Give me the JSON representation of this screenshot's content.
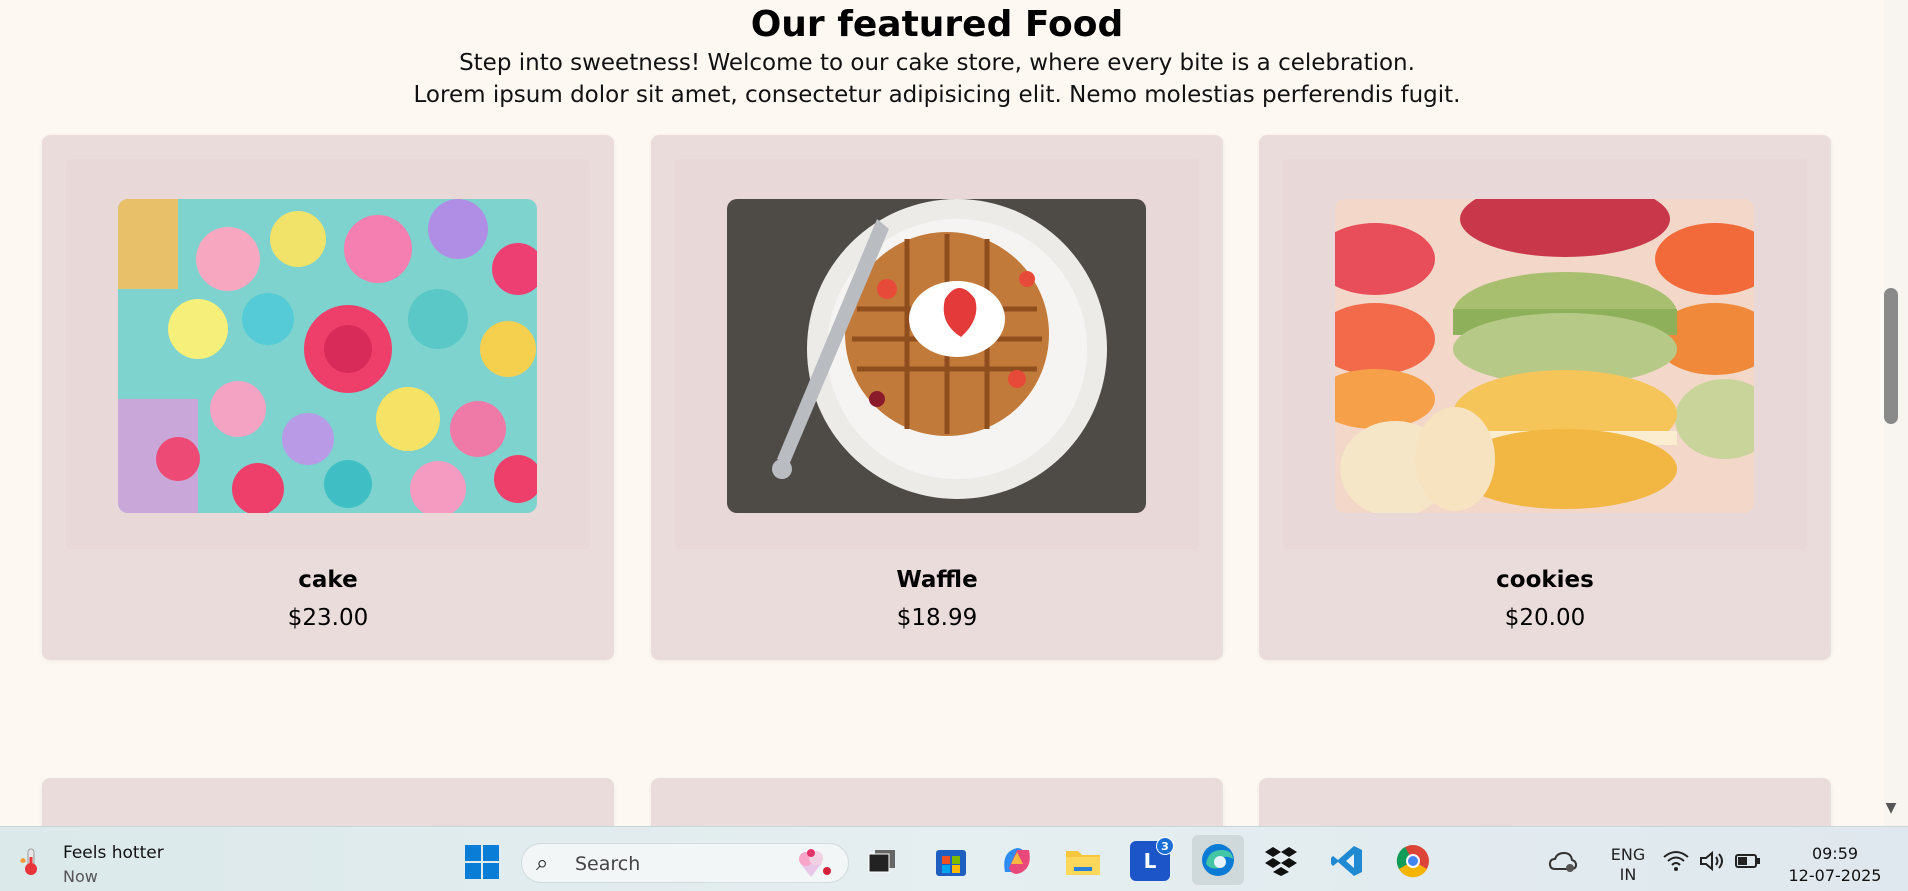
{
  "section": {
    "title": "Our featured Food",
    "subtitle_line1": "Step into sweetness! Welcome to our cake store, where every bite is a celebration.",
    "subtitle_line2": "Lorem ipsum dolor sit amet, consectetur adipisicing elit. Nemo molestias perferendis fugit."
  },
  "products": [
    {
      "name": "cake",
      "price": "$23.00",
      "image": "colorful-frosted-cake"
    },
    {
      "name": "Waffle",
      "price": "$18.99",
      "image": "waffle-with-strawberries"
    },
    {
      "name": "cookies",
      "price": "$20.00",
      "image": "stacked-macarons"
    }
  ],
  "taskbar": {
    "weather_title": "Feels hotter",
    "weather_sub": "Now",
    "search_label": "Search",
    "apps": [
      {
        "name": "task-view",
        "icon": "task-view-icon"
      },
      {
        "name": "microsoft-store",
        "icon": "store-icon"
      },
      {
        "name": "copilot",
        "icon": "copilot-icon"
      },
      {
        "name": "file-explorer",
        "icon": "folder-icon"
      },
      {
        "name": "l-app",
        "icon": "l-app-icon",
        "badge": "3"
      },
      {
        "name": "edge",
        "icon": "edge-icon"
      },
      {
        "name": "dropbox",
        "icon": "dropbox-icon"
      },
      {
        "name": "vscode",
        "icon": "vscode-icon"
      },
      {
        "name": "chrome",
        "icon": "chrome-icon"
      }
    ],
    "lang_line1": "ENG",
    "lang_line2": "IN",
    "time": "09:59",
    "date": "12-07-2025"
  },
  "colors": {
    "page_bg": "#fdf8f2",
    "card_bg": "#ebdcdc",
    "accent": "#0a7ed6"
  }
}
